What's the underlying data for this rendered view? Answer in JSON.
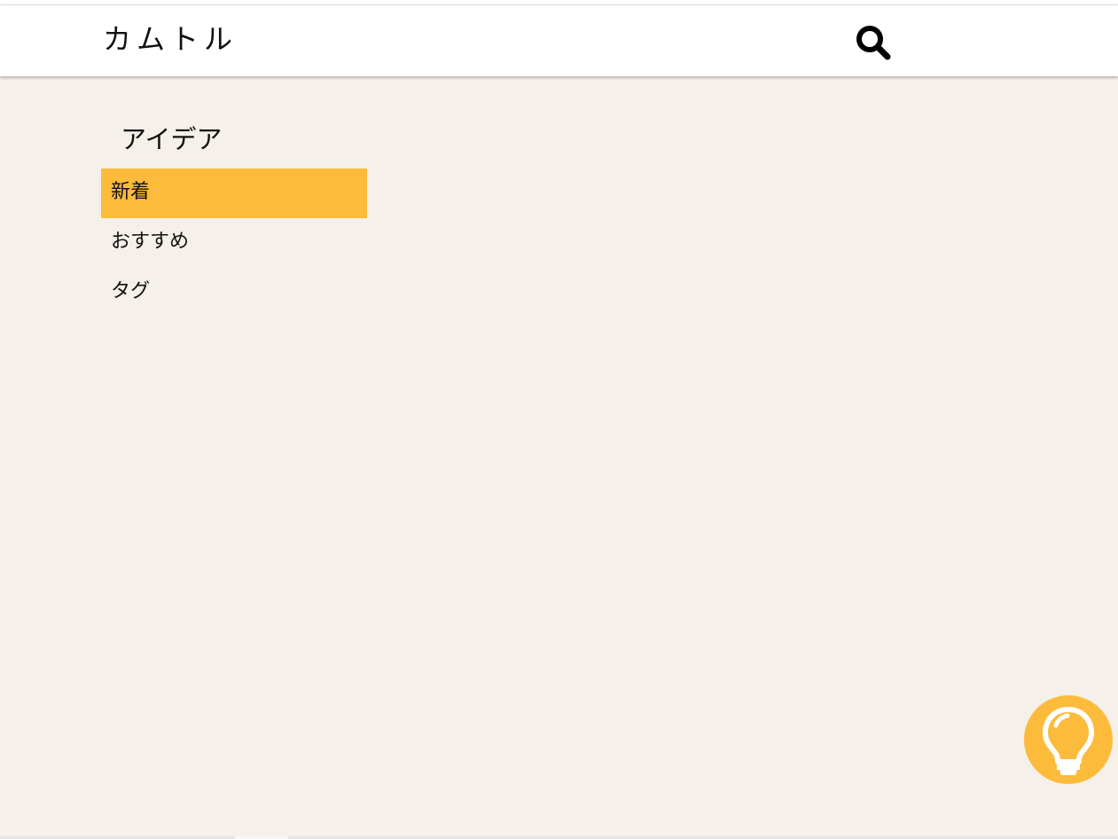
{
  "header": {
    "logo": "カムトル",
    "search_icon": "search-icon"
  },
  "sidebar": {
    "title": "アイデア",
    "items": [
      {
        "label": "新着",
        "active": true
      },
      {
        "label": "おすすめ",
        "active": false
      },
      {
        "label": "タグ",
        "active": false
      }
    ]
  },
  "fab": {
    "icon": "lightbulb-icon"
  },
  "colors": {
    "background": "#f5f0e9",
    "accent": "#fdbb3c",
    "header": "#ffffff"
  }
}
